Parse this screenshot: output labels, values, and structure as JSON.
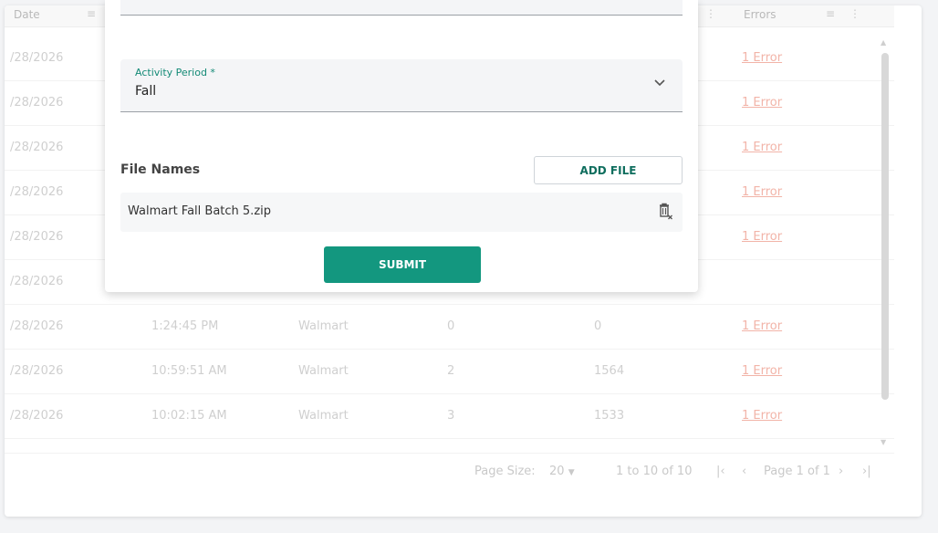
{
  "grid": {
    "header": {
      "date": "Date",
      "errors": "Errors"
    },
    "rows": [
      {
        "date": "/28/2026",
        "time": "",
        "vendor": "",
        "a": "",
        "b": "",
        "errors": "1 Error"
      },
      {
        "date": "/28/2026",
        "time": "",
        "vendor": "",
        "a": "",
        "b": "",
        "errors": "1 Error"
      },
      {
        "date": "/28/2026",
        "time": "",
        "vendor": "",
        "a": "",
        "b": "",
        "errors": "1 Error"
      },
      {
        "date": "/28/2026",
        "time": "",
        "vendor": "",
        "a": "",
        "b": "",
        "errors": "1 Error"
      },
      {
        "date": "/28/2026",
        "time": "",
        "vendor": "",
        "a": "",
        "b": "",
        "errors": "1 Error"
      },
      {
        "date": "/28/2026",
        "time": "",
        "vendor": "",
        "a": "",
        "b": "",
        "errors": ""
      },
      {
        "date": "/28/2026",
        "time": "1:24:45 PM",
        "vendor": "Walmart",
        "a": "0",
        "b": "0",
        "errors": "1 Error"
      },
      {
        "date": "/28/2026",
        "time": "10:59:51 AM",
        "vendor": "Walmart",
        "a": "2",
        "b": "1564",
        "errors": "1 Error"
      },
      {
        "date": "/28/2026",
        "time": "10:02:15 AM",
        "vendor": "Walmart",
        "a": "3",
        "b": "1533",
        "errors": "1 Error"
      }
    ],
    "footer": {
      "page_size_label": "Page Size:",
      "page_size_value": "20",
      "range": "1 to 10 of 10",
      "page": "Page 1 of 1"
    }
  },
  "modal": {
    "activity_period_label": "Activity Period *",
    "activity_period_value": "Fall",
    "file_names_title": "File Names",
    "add_file_label": "ADD FILE",
    "files": [
      {
        "name": "Walmart Fall Batch 5.zip"
      }
    ],
    "submit_label": "SUBMIT"
  },
  "colors": {
    "accent": "#13977f",
    "error_link": "#f2b4a8"
  }
}
